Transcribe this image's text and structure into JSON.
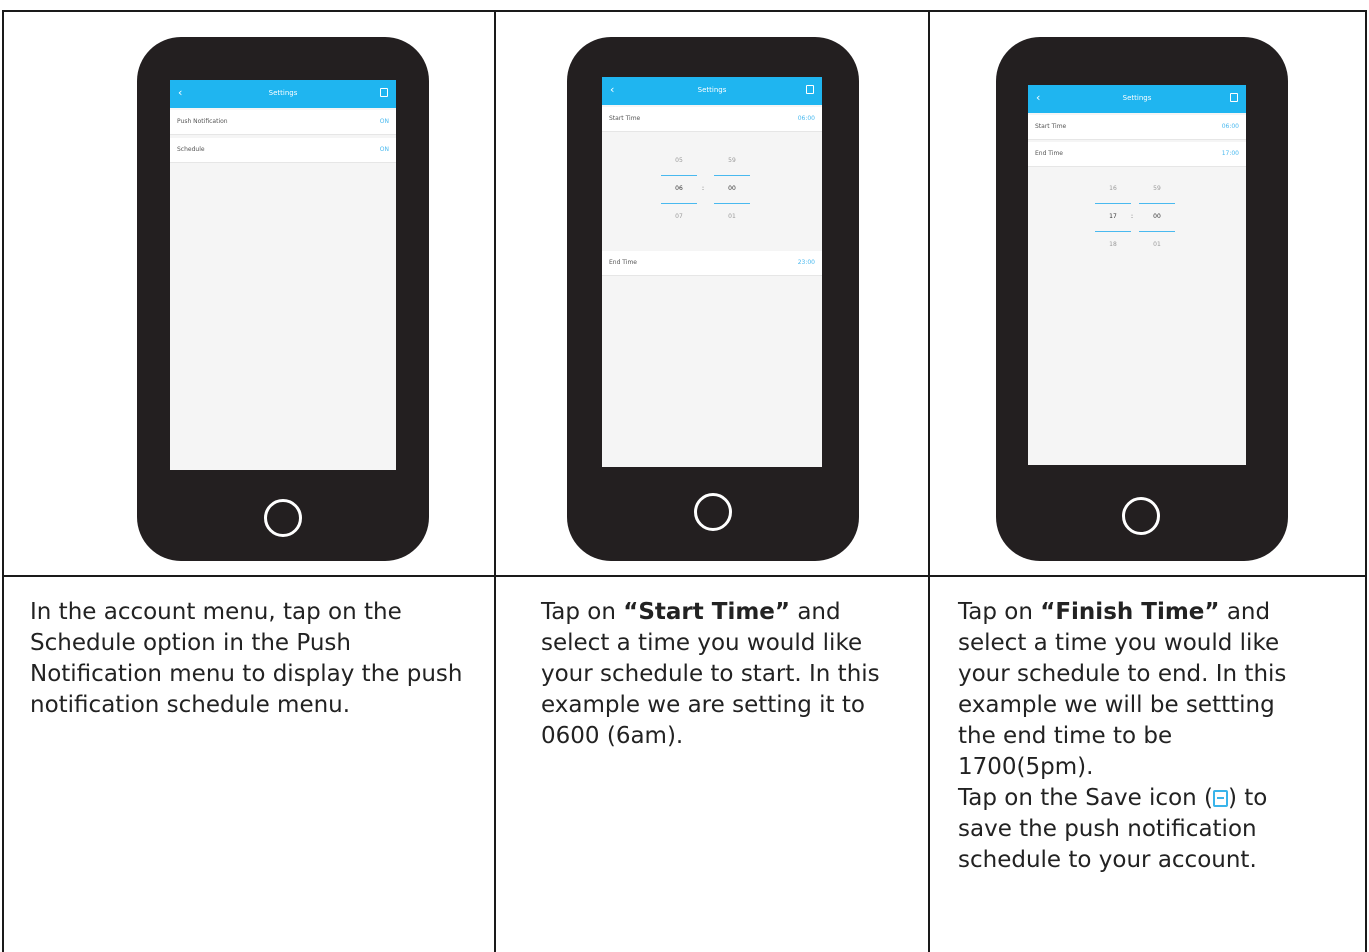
{
  "panels": [
    {
      "screen": {
        "title": "Settings",
        "rows": [
          {
            "label": "Push Notification",
            "value": "ON"
          },
          {
            "label": "Schedule",
            "value": "ON"
          }
        ]
      },
      "caption": "In the account menu, tap on the Schedule option in the Push Notification menu to display the push notification schedule menu."
    },
    {
      "screen": {
        "title": "Settings",
        "start_label": "Start Time",
        "start_value": "06:00",
        "end_label": "End Time",
        "end_value": "23:00",
        "picker": {
          "above": [
            "05",
            "59"
          ],
          "selected": [
            "06",
            "00"
          ],
          "below": [
            "07",
            "01"
          ],
          "separator": ":"
        }
      },
      "caption_pre": "Tap on ",
      "caption_bold": "“Start Time”",
      "caption_post": " and select a time you would like your schedule to start. In this example we are setting it to 0600 (6am)."
    },
    {
      "screen": {
        "title": "Settings",
        "start_label": "Start Time",
        "start_value": "06:00",
        "end_label": "End Time",
        "end_value": "17:00",
        "picker": {
          "above": [
            "16",
            "59"
          ],
          "selected": [
            "17",
            "00"
          ],
          "below": [
            "18",
            "01"
          ],
          "separator": ":"
        }
      },
      "caption_pre": "Tap on ",
      "caption_bold": "“Finish Time”",
      "caption_post": " and select a time you would like your schedule to end. In this example we will be settting the end time to be 1700(5pm).",
      "caption_save_pre": "Tap on the Save icon (",
      "caption_save_post": ") to save the push notification schedule to your account."
    }
  ],
  "colors": {
    "accent": "#1fb5f0",
    "phone": "#231f20",
    "rule": "#1a1a1a"
  },
  "icons": {
    "back": "chevron-left-icon",
    "save": "floppy-save-icon",
    "home": "home-button-icon"
  }
}
